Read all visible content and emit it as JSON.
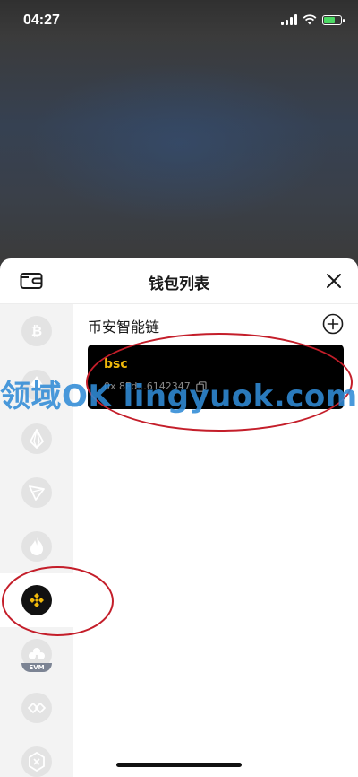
{
  "status_bar": {
    "time": "04:27"
  },
  "sheet": {
    "title": "钱包列表",
    "header_icon": "wallet-icon",
    "close_icon": "close-icon"
  },
  "sidebar": {
    "items": [
      {
        "name": "bitcoin",
        "icon": "bitcoin-icon",
        "active": false
      },
      {
        "name": "ethereum",
        "icon": "ethereum-icon",
        "active": false
      },
      {
        "name": "eos",
        "icon": "eos-icon",
        "active": false
      },
      {
        "name": "tron",
        "icon": "tron-icon",
        "active": false
      },
      {
        "name": "huobi",
        "icon": "flame-icon",
        "active": false
      },
      {
        "name": "bsc",
        "icon": "binance-icon",
        "active": true
      },
      {
        "name": "evm",
        "icon": "evm-icon",
        "label": "EVM",
        "active": false
      },
      {
        "name": "polygon",
        "icon": "polygon-icon",
        "active": false
      },
      {
        "name": "other",
        "icon": "hexagon-chain-icon",
        "active": false
      }
    ]
  },
  "main": {
    "section_title": "币安智能链",
    "add_icon": "plus-circle-icon",
    "wallet": {
      "name": "bsc",
      "address": "0x 8Fd...6142347",
      "copy_icon": "copy-icon"
    }
  },
  "watermark": {
    "text": "领域OK lingyuok.com"
  },
  "colors": {
    "accent": "#f0b90b",
    "annotation": "#c41e2a",
    "watermark": "#308bd6",
    "card_bg": "#000000",
    "sidebar_bg": "#f3f3f3"
  }
}
